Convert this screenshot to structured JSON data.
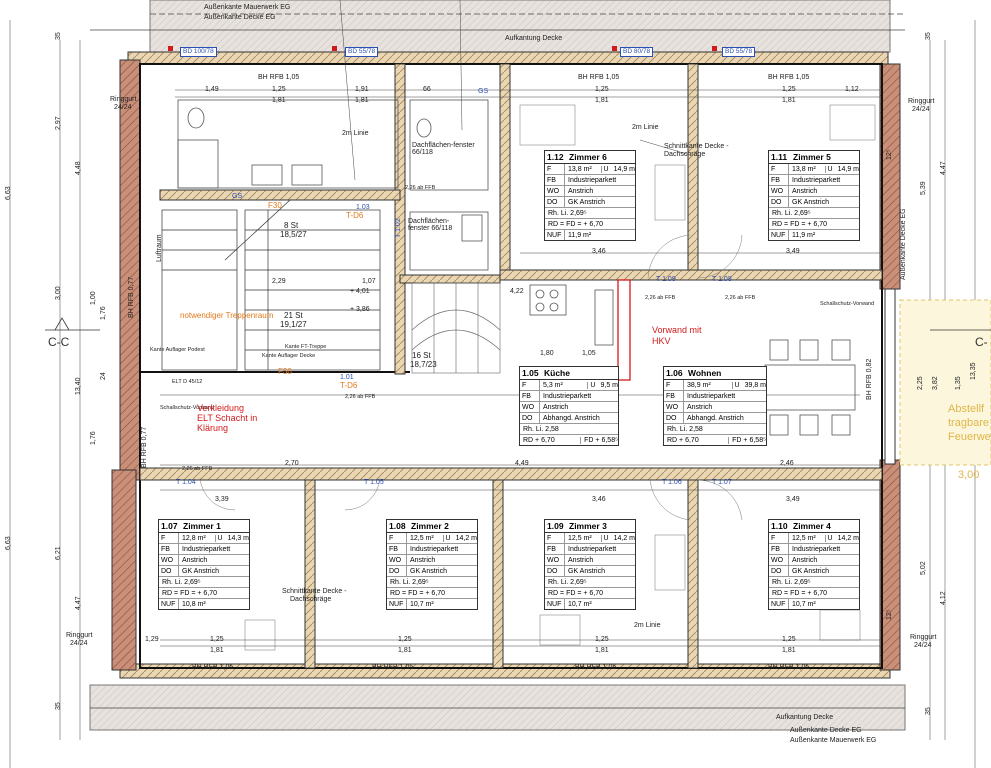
{
  "top_labels": {
    "mauerwerk_eg": "Außenkante Mauerwerk EG",
    "decke_eg": "Außenkante Decke EG",
    "aufkantung": "Aufkantung Decke"
  },
  "bottom_labels": {
    "aufkantung": "Aufkantung Decke",
    "decke_eg": "Außenkante Decke EG",
    "mauerwerk_eg": "Außenkante Mauerwerk EG"
  },
  "side_labels": {
    "ringgurt": "Ringgurt",
    "ringgurt_size": "24/24",
    "decke_eg_vertical": "Außenkante Decke EG",
    "section_left": "C-C",
    "section_right": "C-",
    "schallschutz_vorwand": "Schallschutz-Vorwand",
    "right_overlay": [
      "Abstellf",
      "tragbare",
      "Feuerwe"
    ],
    "right_value": "3,00"
  },
  "window_tags": [
    "BD 100/78",
    "BD 55/78",
    "BD 80/78",
    "BD 55/78"
  ],
  "bh_labels": {
    "top": [
      "BH RFB 1,05",
      "BH RFB 1,05",
      "BH RFB 1,05"
    ],
    "bottom": [
      "BH RFB 1,05",
      "BH RFB 1,05",
      "BH RFB 1,05",
      "BH RFB 1,05"
    ],
    "left_vertical": [
      "BH RFB 0,77",
      "BH RFB 0,77"
    ],
    "right_vertical": "BH RFB 0,82"
  },
  "stair": {
    "upper": "8 St",
    "upper_ratio": "18,5/27",
    "lower": "21 St",
    "lower_ratio": "19,1/27",
    "treppenraum": "notwendiger Treppenraum",
    "luftraum": "Luftraum",
    "kante_podest": "Kante Auflager Podest",
    "kante_decke": "Kante Auflager Decke",
    "kante_ft": "Kante FT-Treppe",
    "level_a": "+ 4,01",
    "level_b": "+ 3,86",
    "room_103": "1.03",
    "room_101": "1.01",
    "t_d6_a": "T-D6",
    "t_d6_b": "T-D6",
    "f30_a": "F30",
    "f30_b": "F30",
    "elt_d": "ELT D 45/12",
    "spiral": "16 St",
    "spiral_ratio": "18,7/23"
  },
  "bath": {
    "linie": "2m Linie",
    "dachflaechen_a": "Dachflächen-fenster 66/118",
    "dachflaechen_b": "Dachflächen-fenster 66/118",
    "gs_a": "GS",
    "gs_b": "GS"
  },
  "notes": {
    "verkleidung": [
      "Verkleidung",
      "ELT Schacht in",
      "Klärung"
    ],
    "vorwand": [
      "Vorwand mit",
      "HKV"
    ],
    "schnittkante_top": [
      "Schnittkante Decke -",
      "Dachschräge"
    ],
    "schnittkante_bottom": [
      "Schnittkante Decke -",
      "Dachschräge"
    ],
    "linie_a": "2m Linie",
    "linie_b": "2m Linie"
  },
  "doors": [
    "T 1.09",
    "T 1.08",
    "T 1.04",
    "T 1.05",
    "T 1.06",
    "T 1.07",
    "T 1.02"
  ],
  "rooms": [
    {
      "num": "1.12",
      "name": "Zimmer 6",
      "f": "13,8 m²",
      "u": "14,9 m",
      "fb": "Industrieparkett",
      "wo": "Anstrich",
      "do": "GK Anstrich",
      "rh": "Rh. Li.  2,69⁵",
      "rd": "RD = FD = + 6,70",
      "nuf": "11,9 m²"
    },
    {
      "num": "1.11",
      "name": "Zimmer 5",
      "f": "13,8 m²",
      "u": "14,9 m",
      "fb": "Industrieparkett",
      "wo": "Anstrich",
      "do": "GK Anstrich",
      "rh": "Rh. Li.  2,69⁵",
      "rd": "RD = FD = + 6,70",
      "nuf": "11,9 m²"
    },
    {
      "num": "1.07",
      "name": "Zimmer 1",
      "f": "12,8 m²",
      "u": "14,3 m",
      "fb": "Industrieparkett",
      "wo": "Anstrich",
      "do": "GK Anstrich",
      "rh": "Rh. Li.  2,69⁵",
      "rd": "RD = FD = + 6,70",
      "nuf": "10,8 m²"
    },
    {
      "num": "1.08",
      "name": "Zimmer 2",
      "f": "12,5 m²",
      "u": "14,2 m",
      "fb": "Industrieparkett",
      "wo": "Anstrich",
      "do": "GK Anstrich",
      "rh": "Rh. Li.  2,69⁵",
      "rd": "RD = FD = + 6,70",
      "nuf": "10,7 m²"
    },
    {
      "num": "1.09",
      "name": "Zimmer 3",
      "f": "12,5 m²",
      "u": "14,2 m",
      "fb": "Industrieparkett",
      "wo": "Anstrich",
      "do": "GK Anstrich",
      "rh": "Rh. Li.  2,69⁵",
      "rd": "RD = FD = + 6,70",
      "nuf": "10,7 m²"
    },
    {
      "num": "1.10",
      "name": "Zimmer 4",
      "f": "12,5 m²",
      "u": "14,2 m",
      "fb": "Industrieparkett",
      "wo": "Anstrich",
      "do": "GK Anstrich",
      "rh": "Rh. Li.  2,69⁵",
      "rd": "RD = FD = + 6,70",
      "nuf": "10,7 m²"
    },
    {
      "num": "1.05",
      "name": "Küche",
      "f": "5,3 m²",
      "u": "9,5 m",
      "fb": "Industrieparkett",
      "wo": "Anstrich",
      "do": "Abhangd. Anstrich",
      "rh": "Rh. Li.  2,58",
      "rd": "RD + 6,70",
      "nuf": "FD + 6,58⁵"
    },
    {
      "num": "1.06",
      "name": "Wohnen",
      "f": "38,9 m²",
      "u": "39,8 m",
      "fb": "Industrieparkett",
      "wo": "Anstrich",
      "do": "Abhangd. Anstrich",
      "rh": "Rh. Li.  2,58",
      "rd": "RD + 6,70",
      "nuf": "FD + 6,58⁵"
    }
  ],
  "dims": {
    "top_row": [
      "1,49",
      "1,25",
      "1,91",
      "66",
      "1,25",
      "1,25",
      "1,12"
    ],
    "top_row2": [
      "1,81",
      "1,81",
      "1,81",
      "1,81"
    ],
    "mid_a": "3,46",
    "mid_b": "3,49",
    "mid_c": "4,22",
    "mid_d": "1,80",
    "mid_e": "1,05",
    "bottom_a": "2,70",
    "bottom_b": "4,49",
    "bottom_c": "2,46",
    "bottom_d": "3,39",
    "bottom_e": "3,46",
    "bottom_f": "3,49",
    "bottom_row": [
      "1,29",
      "1,25",
      "1,25",
      "1,25",
      "1,25"
    ],
    "bottom_row2": [
      "1,81",
      "1,81",
      "1,81",
      "1,81"
    ],
    "ffb_a": "2,26 ab FFB",
    "ffb_b": "2,26 ab FFB",
    "ffb_c": "2,26 ab FFB",
    "ffb_d": "2,26 ab FFB",
    "ffb_e": "2,26 ab FFB",
    "left_v": [
      "35",
      "2,97",
      "4,48",
      "3,00",
      "13,40",
      "1,00",
      "1,76",
      "24",
      "1,76",
      "6,21",
      "4,47",
      "35",
      "6,63",
      "6,63"
    ],
    "right_v": [
      "35",
      "4,47",
      "5,39",
      "1,35",
      "3,82",
      "2,25",
      "13,35",
      "5,02",
      "4,12",
      "35",
      "12⁵",
      "12⁵"
    ],
    "stair_w": "1,07",
    "stair_h": "2,29"
  }
}
